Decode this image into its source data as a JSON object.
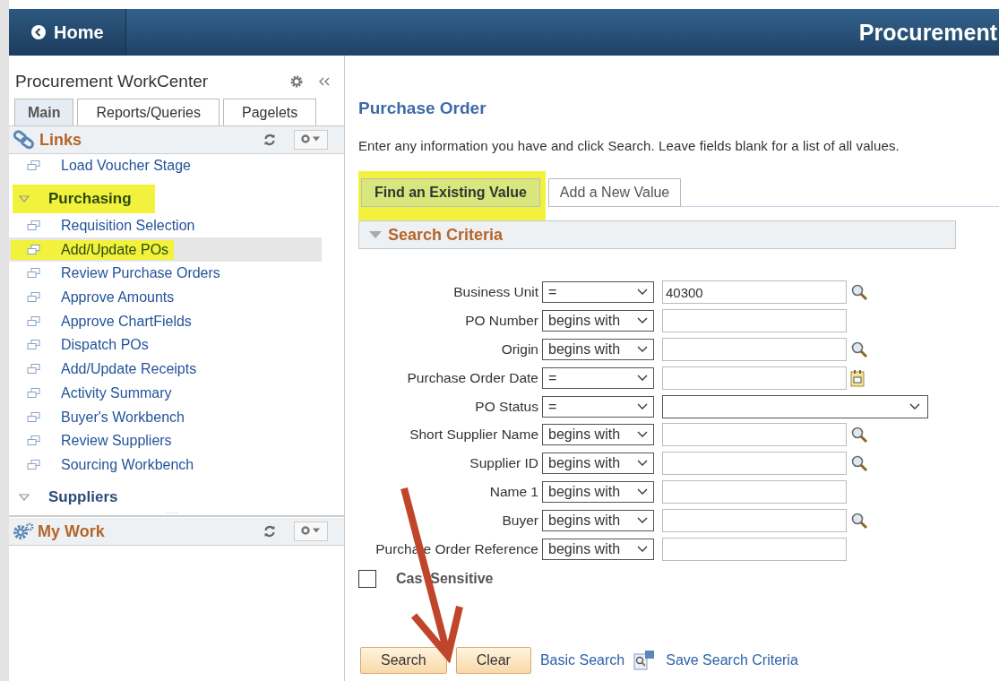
{
  "header": {
    "home_label": "Home",
    "title": "Procurement"
  },
  "sidebar": {
    "title": "Procurement WorkCenter",
    "tabs": [
      {
        "label": "Main",
        "selected": true
      },
      {
        "label": "Reports/Queries",
        "selected": false
      },
      {
        "label": "Pagelets",
        "selected": false
      }
    ],
    "links_title": "Links",
    "items": [
      {
        "kind": "link",
        "label": "Load Voucher Stage",
        "selected": false,
        "highlighted": false
      },
      {
        "kind": "group",
        "label": "Purchasing",
        "expanded": true,
        "highlighted": true,
        "children": [
          {
            "kind": "link",
            "label": "Requisition Selection",
            "selected": false,
            "highlighted": false
          },
          {
            "kind": "link",
            "label": "Add/Update POs",
            "selected": true,
            "highlighted": true
          },
          {
            "kind": "link",
            "label": "Review Purchase Orders",
            "selected": false,
            "highlighted": false
          },
          {
            "kind": "link",
            "label": "Approve Amounts",
            "selected": false,
            "highlighted": false
          },
          {
            "kind": "link",
            "label": "Approve ChartFields",
            "selected": false,
            "highlighted": false
          },
          {
            "kind": "link",
            "label": "Dispatch POs",
            "selected": false,
            "highlighted": false
          },
          {
            "kind": "link",
            "label": "Add/Update Receipts",
            "selected": false,
            "highlighted": false
          },
          {
            "kind": "link",
            "label": "Activity Summary",
            "selected": false,
            "highlighted": false
          },
          {
            "kind": "link",
            "label": "Buyer's Workbench",
            "selected": false,
            "highlighted": false
          },
          {
            "kind": "link",
            "label": "Review Suppliers",
            "selected": false,
            "highlighted": false
          },
          {
            "kind": "link",
            "label": "Sourcing Workbench",
            "selected": false,
            "highlighted": false
          }
        ]
      },
      {
        "kind": "group",
        "label": "Suppliers",
        "expanded": true,
        "highlighted": false
      }
    ],
    "my_work_title": "My Work"
  },
  "main": {
    "title": "Purchase Order",
    "instructions": "Enter any information you have and click Search. Leave fields blank for a list of all values.",
    "tabs": [
      {
        "label": "Find an Existing Value",
        "selected": true,
        "highlighted": true
      },
      {
        "label": "Add a New Value",
        "selected": false,
        "highlighted": false
      }
    ],
    "section": {
      "title": "Search Criteria",
      "expanded": true
    },
    "criteria": [
      {
        "label": "Business Unit",
        "operator": "=",
        "kind": "lookup",
        "value": "40300"
      },
      {
        "label": "PO Number",
        "operator": "begins with",
        "kind": "text"
      },
      {
        "label": "Origin",
        "operator": "begins with",
        "kind": "lookup"
      },
      {
        "label": "Purchase Order Date",
        "operator": "=",
        "kind": "date"
      },
      {
        "label": "PO Status",
        "operator": "=",
        "kind": "dropdown"
      },
      {
        "label": "Short Supplier Name",
        "operator": "begins with",
        "kind": "lookup"
      },
      {
        "label": "Supplier ID",
        "operator": "begins with",
        "kind": "lookup"
      },
      {
        "label": "Name 1",
        "operator": "begins with",
        "kind": "text"
      },
      {
        "label": "Buyer",
        "operator": "begins with",
        "kind": "lookup"
      },
      {
        "label": "Purcha e Order Reference",
        "operator": "begins with",
        "kind": "text"
      }
    ],
    "case_sensitive": {
      "label": "Cas  Sensitive",
      "checked": false
    },
    "buttons": [
      {
        "label": "Search"
      },
      {
        "label": "Clear"
      }
    ],
    "links": [
      {
        "label": "Basic Search",
        "kind": "plain"
      },
      {
        "label": "Save Search Criteria",
        "kind": "save"
      }
    ]
  }
}
